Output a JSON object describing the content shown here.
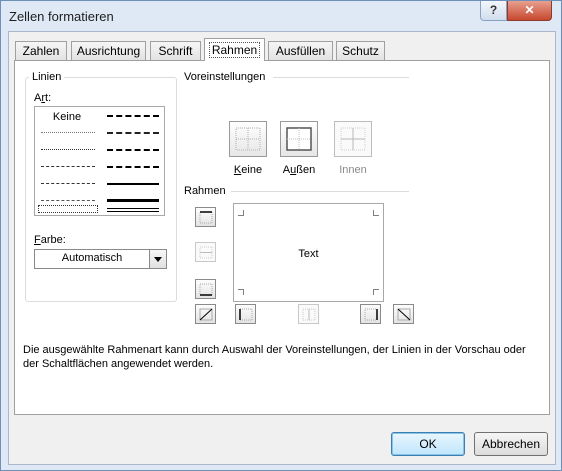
{
  "window": {
    "title": "Zellen formatieren",
    "help_symbol": "?",
    "close_symbol": "✕"
  },
  "tabs": [
    {
      "label": "Zahlen",
      "active": false
    },
    {
      "label": "Ausrichtung",
      "active": false
    },
    {
      "label": "Schrift",
      "active": false
    },
    {
      "label": "Rahmen",
      "active": true
    },
    {
      "label": "Ausfüllen",
      "active": false
    },
    {
      "label": "Schutz",
      "active": false
    }
  ],
  "lines_group": {
    "title": "Linien",
    "style_label_pre": "A",
    "style_label_u": "r",
    "style_label_post": "t:",
    "style_none_label": "Keine",
    "color_label_u": "F",
    "color_label_post": "arbe:",
    "color_value": "Automatisch"
  },
  "presets_section": {
    "title": "Voreinstellungen",
    "none_u": "K",
    "none_rest": "eine",
    "outline_pre": "A",
    "outline_u": "u",
    "outline_rest": "ßen",
    "inside": "Innen"
  },
  "border_section": {
    "title": "Rahmen",
    "preview_text": "Text"
  },
  "description": "Die ausgewählte Rahmenart kann durch Auswahl der Voreinstellungen, der Linien in der Vorschau oder der Schaltflächen angewendet werden.",
  "buttons": {
    "ok": "OK",
    "cancel": "Abbrechen"
  },
  "colors": {
    "title_bar": "#dfe9f5",
    "close_button": "#c7482f",
    "default_button": "#bee6fd"
  }
}
